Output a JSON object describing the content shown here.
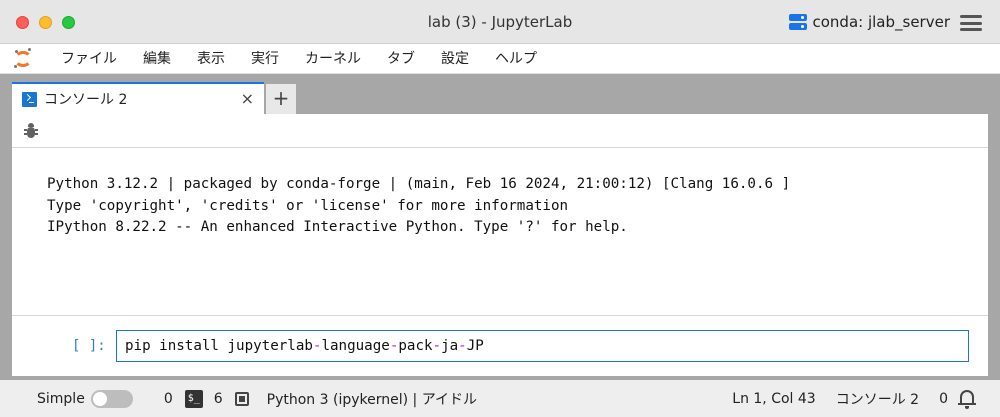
{
  "window": {
    "title": "lab (3) - JupyterLab",
    "environment": "conda: jlab_server"
  },
  "menu": {
    "items": [
      "ファイル",
      "編集",
      "表示",
      "実行",
      "カーネル",
      "タブ",
      "設定",
      "ヘルプ"
    ]
  },
  "tabs": [
    {
      "label": "コンソール 2",
      "close": "×"
    }
  ],
  "tab_add": "+",
  "console": {
    "banner": [
      "Python 3.12.2 | packaged by conda-forge | (main, Feb 16 2024, 21:00:12) [Clang 16.0.6 ]",
      "Type 'copyright', 'credits' or 'license' for more information",
      "IPython 8.22.2 -- An enhanced Interactive Python. Type '?' for help."
    ],
    "prompt": "[ ]:",
    "input_parts": [
      "pip install jupyterlab",
      "-",
      "language",
      "-",
      "pack",
      "-",
      "ja",
      "-",
      "JP"
    ]
  },
  "status": {
    "simple_label": "Simple",
    "count_a": "0",
    "terminal_icon": "$_",
    "count_b": "6",
    "kernel": "Python 3 (ipykernel) | アイドル",
    "cursor": "Ln 1, Col 43",
    "console_name": "コンソール 2",
    "notifications": "0"
  },
  "colors": {
    "accent": "#1a73e8",
    "prompt": "#307fc1",
    "operator": "#aa22ff",
    "logo": "#f37726"
  }
}
